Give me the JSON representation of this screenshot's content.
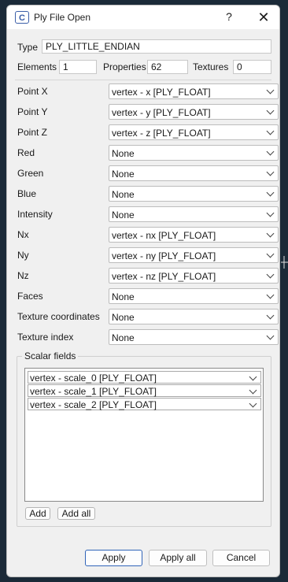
{
  "window": {
    "title": "Ply File Open",
    "icon": "cloudcompare-logo",
    "help_label": "?",
    "close_label": "✕"
  },
  "header": {
    "type_label": "Type",
    "type_value": "PLY_LITTLE_ENDIAN",
    "elements_label": "Elements",
    "elements_value": "1",
    "properties_label": "Properties",
    "properties_value": "62",
    "textures_label": "Textures",
    "textures_value": "0"
  },
  "fields": [
    {
      "label": "Point X",
      "value": "vertex - x [PLY_FLOAT]"
    },
    {
      "label": "Point Y",
      "value": "vertex - y [PLY_FLOAT]"
    },
    {
      "label": "Point Z",
      "value": "vertex - z [PLY_FLOAT]"
    },
    {
      "label": "Red",
      "value": "None"
    },
    {
      "label": "Green",
      "value": "None"
    },
    {
      "label": "Blue",
      "value": "None"
    },
    {
      "label": "Intensity",
      "value": "None"
    },
    {
      "label": "Nx",
      "value": "vertex - nx [PLY_FLOAT]"
    },
    {
      "label": "Ny",
      "value": "vertex - ny [PLY_FLOAT]"
    },
    {
      "label": "Nz",
      "value": "vertex - nz [PLY_FLOAT]"
    },
    {
      "label": "Faces",
      "value": "None"
    },
    {
      "label": "Texture coordinates",
      "value": "None"
    },
    {
      "label": "Texture index",
      "value": "None"
    }
  ],
  "scalar_fields": {
    "title": "Scalar fields",
    "items": [
      "vertex - scale_0 [PLY_FLOAT]",
      "vertex - scale_1 [PLY_FLOAT]",
      "vertex - scale_2 [PLY_FLOAT]"
    ],
    "add_label": "Add",
    "add_all_label": "Add all"
  },
  "buttons": {
    "apply": "Apply",
    "apply_all": "Apply all",
    "cancel": "Cancel"
  },
  "colors": {
    "background": "#f0f0f0",
    "default_button_border": "#2f63b7"
  }
}
